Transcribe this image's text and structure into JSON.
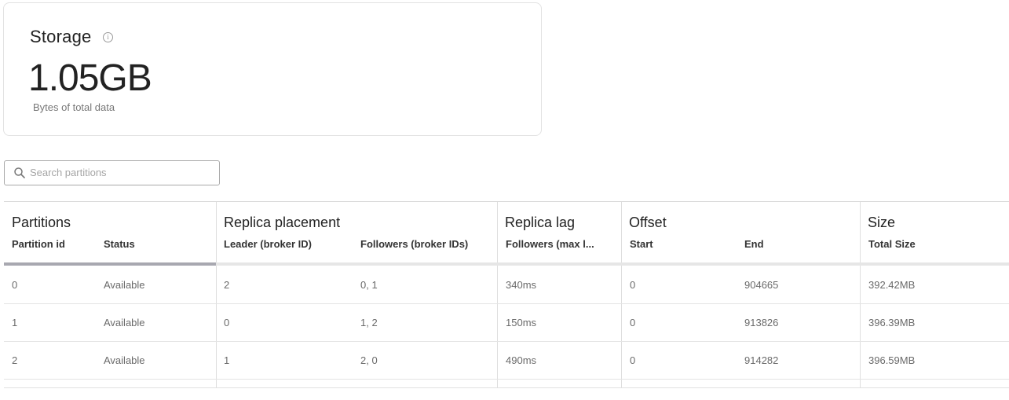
{
  "storage": {
    "title": "Storage",
    "info_icon": "info-icon",
    "value": "1.05GB",
    "caption": "Bytes of total data"
  },
  "search": {
    "icon": "search-icon",
    "placeholder": "Search partitions",
    "value": ""
  },
  "table": {
    "groups": {
      "partitions": "Partitions",
      "replica_placement": "Replica placement",
      "replica_lag": "Replica lag",
      "offset": "Offset",
      "size": "Size"
    },
    "columns": {
      "partition_id": "Partition id",
      "status": "Status",
      "leader": "Leader (broker ID)",
      "followers": "Followers (broker IDs)",
      "lag": "Followers (max l...",
      "start": "Start",
      "end": "End",
      "total_size": "Total Size"
    },
    "rows": [
      {
        "partition_id": "0",
        "status": "Available",
        "leader": "2",
        "followers": "0, 1",
        "lag": "340ms",
        "start": "0",
        "end": "904665",
        "total_size": "392.42MB"
      },
      {
        "partition_id": "1",
        "status": "Available",
        "leader": "0",
        "followers": "1, 2",
        "lag": "150ms",
        "start": "0",
        "end": "913826",
        "total_size": "396.39MB"
      },
      {
        "partition_id": "2",
        "status": "Available",
        "leader": "1",
        "followers": "2, 0",
        "lag": "490ms",
        "start": "0",
        "end": "914282",
        "total_size": "396.59MB"
      }
    ]
  }
}
